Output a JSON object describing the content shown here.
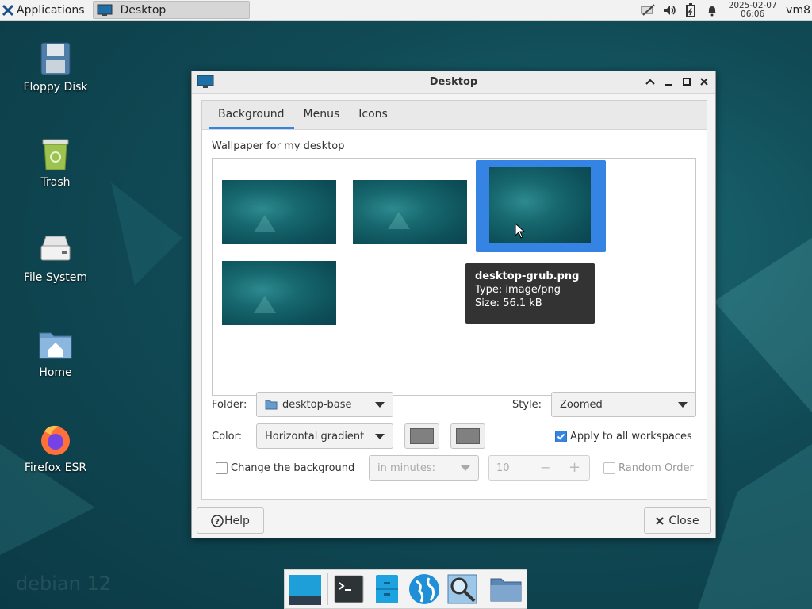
{
  "top_panel": {
    "apps_label": "Applications",
    "taskbar_window": "Desktop",
    "clock_date": "2025-02-07",
    "clock_time": "06:06",
    "user": "vm8"
  },
  "desktop_icons": [
    {
      "label": "Floppy Disk",
      "icon": "floppy-disk-icon"
    },
    {
      "label": "Trash",
      "icon": "trash-icon"
    },
    {
      "label": "File System",
      "icon": "drive-icon"
    },
    {
      "label": "Home",
      "icon": "home-folder-icon"
    },
    {
      "label": "Firefox ESR",
      "icon": "firefox-icon"
    }
  ],
  "watermark": "debian 12",
  "dialog": {
    "title": "Desktop",
    "tabs": [
      {
        "label": "Background",
        "active": true
      },
      {
        "label": "Menus",
        "active": false
      },
      {
        "label": "Icons",
        "active": false
      }
    ],
    "wallpaper_label": "Wallpaper for my desktop",
    "tooltip": {
      "name": "desktop-grub.png",
      "type": "Type: image/png",
      "size": "Size: 56.1 kB"
    },
    "folder_label": "Folder:",
    "folder_value": "desktop-base",
    "style_label": "Style:",
    "style_value": "Zoomed",
    "color_label": "Color:",
    "color_value": "Horizontal gradient",
    "color1": "#808080",
    "color2": "#808080",
    "apply_all_label": "Apply to all workspaces",
    "apply_all_checked": true,
    "change_bg_label": "Change the background",
    "change_bg_checked": false,
    "interval_unit": "in minutes:",
    "interval_value": "10",
    "random_order_label": "Random Order",
    "random_order_checked": false,
    "help_label": "Help",
    "close_label": "Close"
  },
  "colors": {
    "accent": "#3584e4",
    "tooltip_bg": "#333333"
  },
  "dock": [
    "show-desktop-icon",
    "terminal-icon",
    "file-manager-icon",
    "web-browser-icon",
    "app-finder-icon",
    "folder-icon"
  ]
}
